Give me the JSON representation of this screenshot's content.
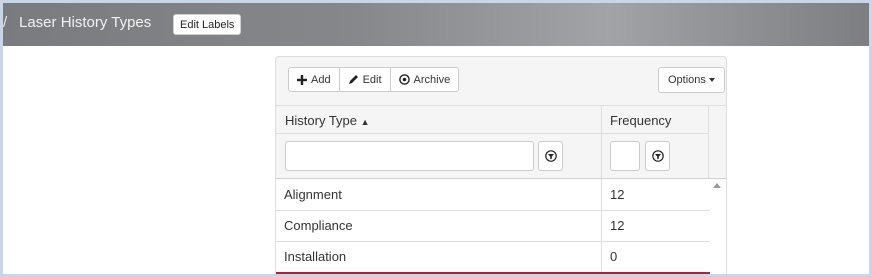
{
  "header": {
    "breadcrumb_sep": "/",
    "title": "Laser History Types",
    "edit_labels": "Edit Labels"
  },
  "toolbar": {
    "add": "Add",
    "edit": "Edit",
    "archive": "Archive",
    "options": "Options"
  },
  "grid": {
    "columns": [
      {
        "label": "History Type",
        "sort_indicator": "▲"
      },
      {
        "label": "Frequency"
      }
    ],
    "filters": {
      "history_type_value": "",
      "frequency_value": ""
    },
    "rows": [
      {
        "history_type": "Alignment",
        "frequency": "12"
      },
      {
        "history_type": "Compliance",
        "frequency": "12"
      },
      {
        "history_type": "Installation",
        "frequency": "0"
      }
    ]
  },
  "colors": {
    "header_bar": "#86878b",
    "selected_row": "#b5202c",
    "page_border": "#c9d6ea"
  }
}
